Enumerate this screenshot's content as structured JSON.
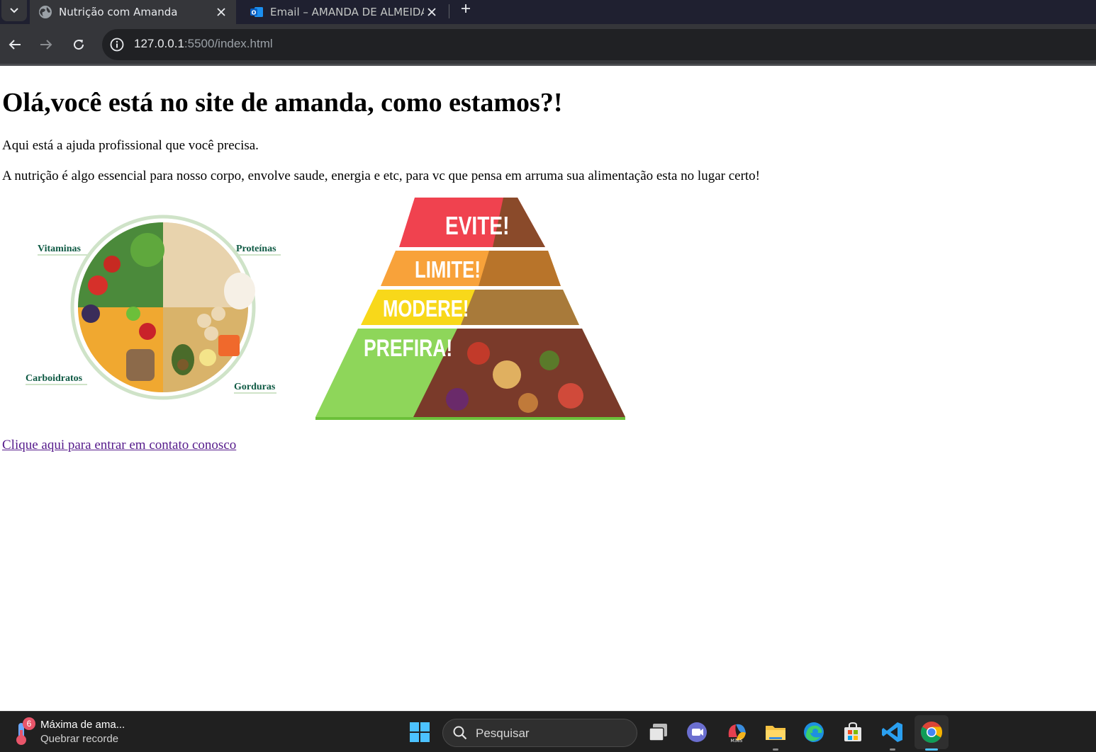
{
  "browser": {
    "tabs": [
      {
        "title": "Nutrição com Amanda",
        "active": true
      },
      {
        "title": "Email – AMANDA DE ALMEIDA",
        "active": false
      }
    ],
    "address": {
      "host": "127.0.0.1",
      "rest": ":5500/index.html"
    }
  },
  "page": {
    "heading": "Olá,você está no site de amanda, como estamos?!",
    "paragraph1": "Aqui está a ajuda profissional que você precisa.",
    "paragraph2": "A nutrição é algo essencial para nosso corpo, envolve saude, energia e etc, para vc que pensa em arruma sua alimentação esta no lugar certo!",
    "plate_labels": {
      "vitaminas": "Vitaminas",
      "proteinas": "Proteínas",
      "carboidratos": "Carboidratos",
      "gorduras": "Gorduras"
    },
    "pyramid_labels": {
      "evite": "EVITE!",
      "limite": "LIMITE!",
      "modere": "MODERE!",
      "prefira": "PREFIRA!"
    },
    "contact_link": "Clique aqui para entrar em contato conosco"
  },
  "taskbar": {
    "weather_badge": "6",
    "weather_title": "Máxima de ama...",
    "weather_subtitle": "Quebrar recorde",
    "search_placeholder": "Pesquisar",
    "icons": [
      "windows-start-icon",
      "task-view-icon",
      "teams-icon",
      "m365-icon",
      "file-explorer-icon",
      "edge-icon",
      "store-icon",
      "vscode-icon",
      "chrome-icon"
    ]
  },
  "colors": {
    "tabstrip": "#1f2030",
    "toolbar": "#35363a",
    "link_visited": "#551a8b",
    "evite": "#f0424f",
    "limite": "#f8a23a",
    "modere": "#f8d81a",
    "prefira": "#8ed65a",
    "plate_label": "#0f5a44"
  }
}
